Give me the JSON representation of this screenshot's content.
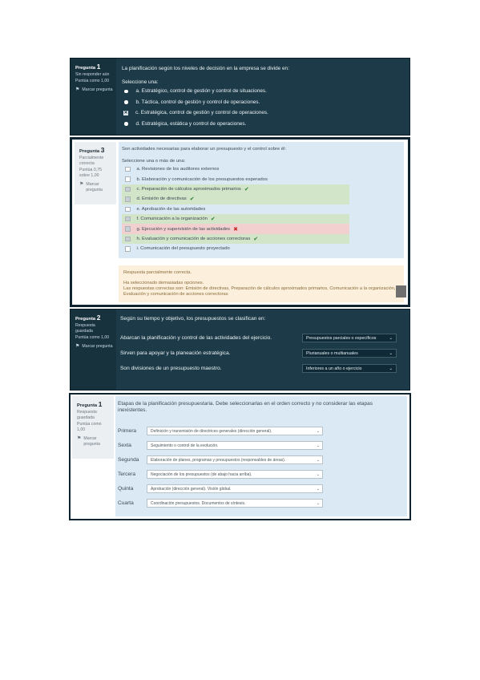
{
  "q1": {
    "number_prefix": "Pregunta",
    "number": "1",
    "status": "Sin responder aún",
    "score": "Puntúa como 1,00",
    "flag": "Marcar pregunta",
    "prompt": "La planificación según los niveles de decisión en la empresa se divide en:",
    "select_label": "Seleccione una:",
    "options": [
      "a. Estratégico, control de gestión y control de situaciones.",
      "b. Táctica, control de gestión y control de operaciones.",
      "c. Estratégica, control de gestión y control de operaciones.",
      "d. Estratégica, estática y control de operaciones."
    ]
  },
  "q3": {
    "number_prefix": "Pregunta",
    "number": "3",
    "status": "Parcialmente correcta",
    "score": "Puntúa 0,75 sobre 1,00",
    "flag": "Marcar pregunta",
    "prompt": "Son actividades necesarias para elaborar un presupuesto y el control sobre él:",
    "select_label": "Seleccione una o más de una:",
    "options": [
      "a. Revisiones de los auditores externos",
      "b. Elaboración y comunicación de los presupuestos esperados",
      "c. Preparación de cálculos aproximados primarios",
      "d. Emisión de directivas",
      "e. Aprobación de las autoridades",
      "f. Comunicación a la organización",
      "g. Ejecución y supervisión de las actividades",
      "h. Evaluación y comunicación de acciones correctoras",
      "i. Comunicación del presupuesto proyectado"
    ],
    "feedback_title": "Respuesta parcialmente correcta.",
    "feedback_selected": "Ha seleccionado demasiadas opciones.",
    "feedback_correct": "Las respuestas correctas son: Emisión de directivas, Preparación de cálculos aproximados primarios, Comunicación a la organización, Evaluación y comunicación de acciones correctoras"
  },
  "q2": {
    "number_prefix": "Pregunta",
    "number": "2",
    "status": "Respuesta guardada",
    "score": "Puntúa como 1,00",
    "flag": "Marcar pregunta",
    "prompt": "Según su tiempo y objetivo, los presupuestos se clasifican en:",
    "rows": [
      {
        "text": "Abarcan la planificación y control de las actividades del ejercicio.",
        "selected": "Presupuestos parciales o específicos"
      },
      {
        "text": "Sirven para apoyar y la planeación estratégica.",
        "selected": "Plurianuales o multianuales"
      },
      {
        "text": "Son divisiones de un presupuesto maestro.",
        "selected": "Inferiores a un año o ejercicio"
      }
    ]
  },
  "q1b": {
    "number_prefix": "Pregunta",
    "number": "1",
    "status": "Respuesta guardada",
    "score": "Puntúa como 1,00",
    "flag": "Marcar pregunta",
    "prompt": "Etapas de la planificación presupuestaria. Debe seleccionarlas en el orden correcto y no considerar las etapas inexistentes.",
    "rows": [
      {
        "label": "Primera",
        "selected": "Definición y transmisión de directrices generales (dirección general)."
      },
      {
        "label": "Sexta",
        "selected": "Seguimiento o control de la evolución."
      },
      {
        "label": "Segunda",
        "selected": "Elaboración de planes, programas y presupuestos (responsables de áreas)."
      },
      {
        "label": "Tercera",
        "selected": "Negociación de los presupuestos (de abajo hacia arriba)."
      },
      {
        "label": "Quinta",
        "selected": "Aprobación (dirección general). Visión global."
      },
      {
        "label": "Cuarta",
        "selected": "Coordinación presupuestos. Documentos de síntesis."
      }
    ]
  }
}
